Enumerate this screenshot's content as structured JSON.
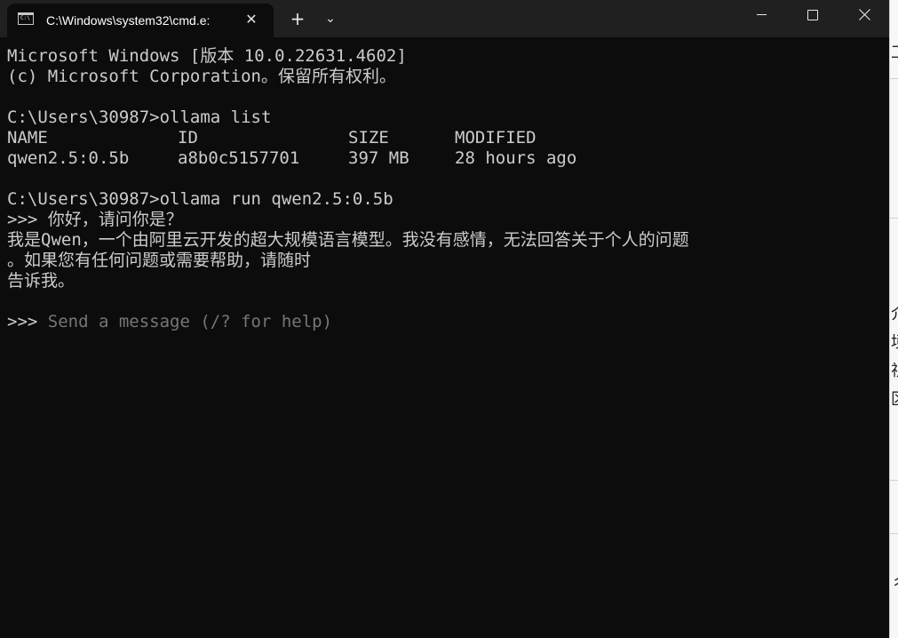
{
  "window": {
    "tab_title": "C:\\Windows\\system32\\cmd.e:",
    "tab_close": "✕",
    "new_tab": "+",
    "dropdown": "⌄",
    "icon_text": "C:\\"
  },
  "console": {
    "lines": [
      "Microsoft Windows [版本 10.0.22631.4602]",
      "(c) Microsoft Corporation。保留所有权利。",
      "",
      "C:\\Users\\30987>ollama list"
    ],
    "table": {
      "headers": [
        "NAME",
        "ID",
        "SIZE",
        "MODIFIED"
      ],
      "rows": [
        [
          "qwen2.5:0.5b",
          "a8b0c5157701",
          "397 MB",
          "28 hours ago"
        ]
      ]
    },
    "lines2": [
      "",
      "C:\\Users\\30987>ollama run qwen2.5:0.5b",
      ">>> 你好，请问你是？",
      "我是Qwen，一个由阿里云开发的超大规模语言模型。我没有感情，无法回答关于个人的问题",
      "。如果您有任何问题或需要帮助，请随时",
      "告诉我。",
      ""
    ],
    "prompt_symbol": ">>> ",
    "prompt_placeholder": "Send a message (/? for help)"
  },
  "background": {
    "fragments": [
      "工",
      "介",
      "境",
      "视",
      "区",
      "彳"
    ]
  },
  "colors": {
    "console_bg": "#0c0c0c",
    "titlebar_bg": "#202020",
    "text": "#cccccc",
    "hint": "#767676"
  }
}
